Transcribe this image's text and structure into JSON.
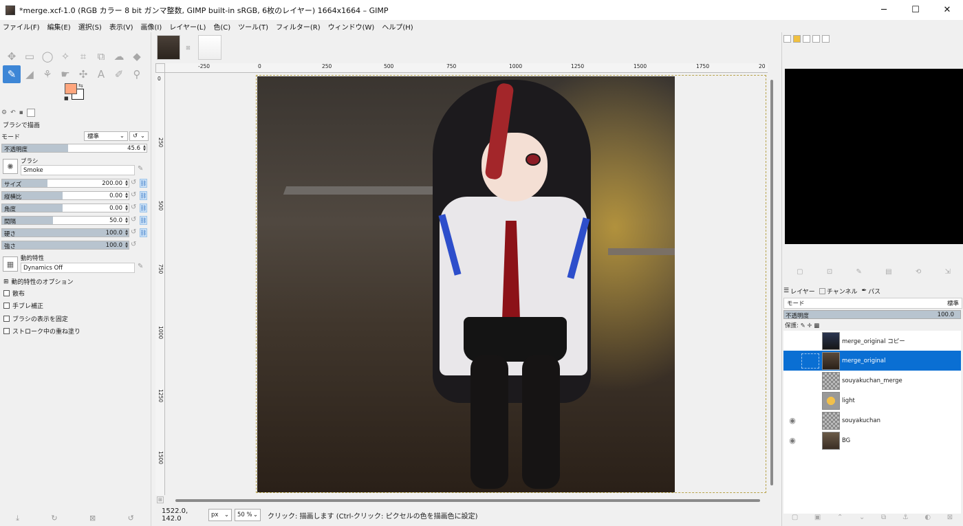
{
  "window": {
    "title": "*merge.xcf-1.0 (RGB カラー 8 bit ガンマ整数, GIMP built-in sRGB, 6枚のレイヤー) 1664x1664 – GIMP",
    "minimize": "─",
    "maximize": "☐",
    "close": "✕"
  },
  "menu": [
    "ファイル(F)",
    "編集(E)",
    "選択(S)",
    "表示(V)",
    "画像(I)",
    "レイヤー(L)",
    "色(C)",
    "ツール(T)",
    "フィルター(R)",
    "ウィンドウ(W)",
    "ヘルプ(H)"
  ],
  "tool_options": {
    "title": "ブラシで描画",
    "mode_label": "モード",
    "mode_value": "標準",
    "opacity_label": "不透明度",
    "opacity_value": "45.6",
    "opacity_fraction": 0.456,
    "brush_label": "ブラシ",
    "brush_value": "Smoke",
    "size_label": "サイズ",
    "size_value": "200.00",
    "aspect_label": "縦横比",
    "aspect_value": "0.00",
    "angle_label": "角度",
    "angle_value": "0.00",
    "spacing_label": "間隔",
    "spacing_value": "50.0",
    "hardness_label": "硬さ",
    "hardness_value": "100.0",
    "force_label": "強さ",
    "force_value": "100.0",
    "dynamics_label": "動的特性",
    "dynamics_value": "Dynamics Off",
    "dynamics_options": "動的特性のオプション",
    "checks": [
      "散布",
      "手ブレ補正",
      "ブラシの表示を固定",
      "ストローク中の重ね塗り"
    ]
  },
  "colors": {
    "fg": "#ffa67e",
    "bg": "#ffffff",
    "accent": "#0a6fd3"
  },
  "ruler": {
    "h": [
      "-250",
      "0",
      "250",
      "500",
      "750",
      "1000",
      "1250",
      "1500",
      "1750",
      "20"
    ],
    "v": [
      "0",
      "250",
      "500",
      "750",
      "1000",
      "1250",
      "1500"
    ]
  },
  "status": {
    "coords": "1522.0, 142.0",
    "unit": "px",
    "zoom": "50 %",
    "message": "クリック: 描画します (Ctrl-クリック: ピクセルの色を描画色に設定)"
  },
  "layers_panel": {
    "tab_layers": "レイヤー",
    "tab_channels": "チャンネル",
    "tab_paths": "パス",
    "mode_label": "モード",
    "mode_value": "標準",
    "opacity_label": "不透明度",
    "opacity_value": "100.0",
    "lock_label": "保護:",
    "layers": [
      {
        "name": "merge_original コピー",
        "visible": false,
        "selected": false
      },
      {
        "name": "merge_original",
        "visible": false,
        "selected": true
      },
      {
        "name": "souyakuchan_merge",
        "visible": false,
        "selected": false
      },
      {
        "name": "light",
        "visible": false,
        "selected": false
      },
      {
        "name": "souyakuchan",
        "visible": true,
        "selected": false
      },
      {
        "name": "BG",
        "visible": true,
        "selected": false
      }
    ]
  }
}
